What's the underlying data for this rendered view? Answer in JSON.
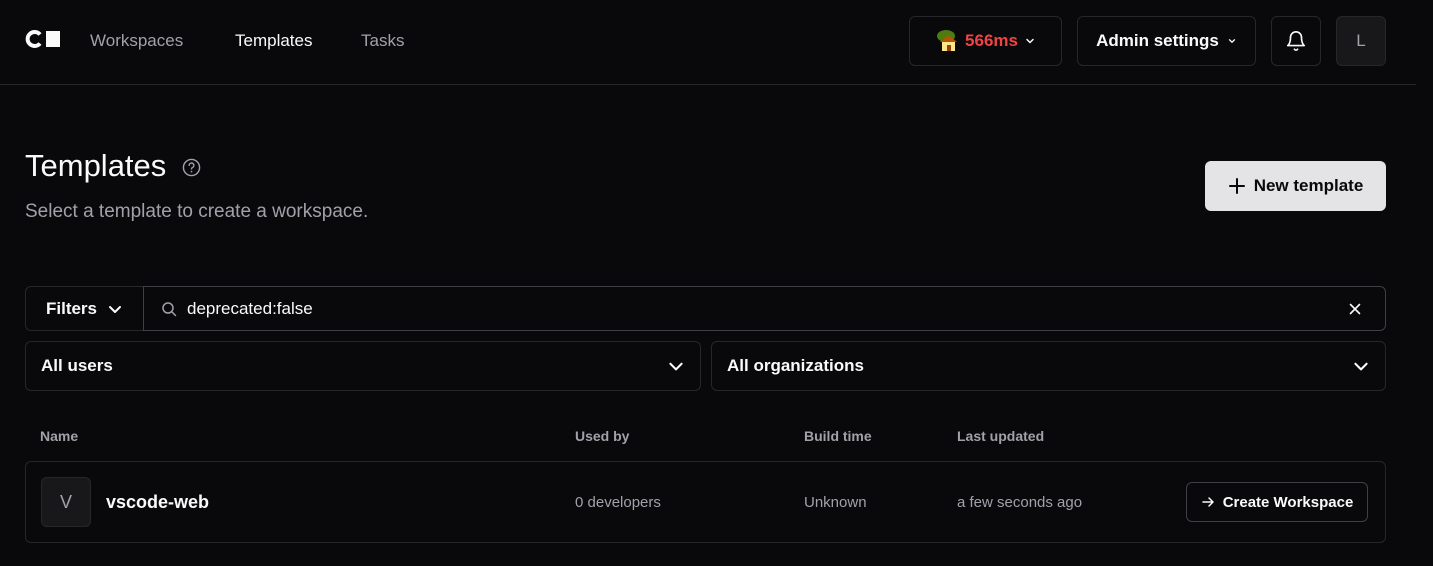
{
  "nav": {
    "logo": "Coder",
    "links": [
      {
        "label": "Workspaces",
        "active": false
      },
      {
        "label": "Templates",
        "active": true
      },
      {
        "label": "Tasks",
        "active": false
      }
    ],
    "latency": "566ms",
    "admin_label": "Admin settings",
    "avatar_initial": "L"
  },
  "header": {
    "title": "Templates",
    "subtitle": "Select a template to create a workspace.",
    "new_template_label": "New template"
  },
  "filters": {
    "button_label": "Filters",
    "search_value": "deprecated:false",
    "users_select": "All users",
    "orgs_select": "All organizations"
  },
  "table": {
    "columns": [
      "Name",
      "Used by",
      "Build time",
      "Last updated"
    ],
    "rows": [
      {
        "initial": "V",
        "name": "vscode-web",
        "used_by": "0 developers",
        "build_time": "Unknown",
        "last_updated": "a few seconds ago",
        "action_label": "Create Workspace"
      }
    ]
  },
  "colors": {
    "background": "#09090b",
    "latency": "#ef4444",
    "primary_button": "#e4e4e7",
    "border": "#27272a"
  }
}
